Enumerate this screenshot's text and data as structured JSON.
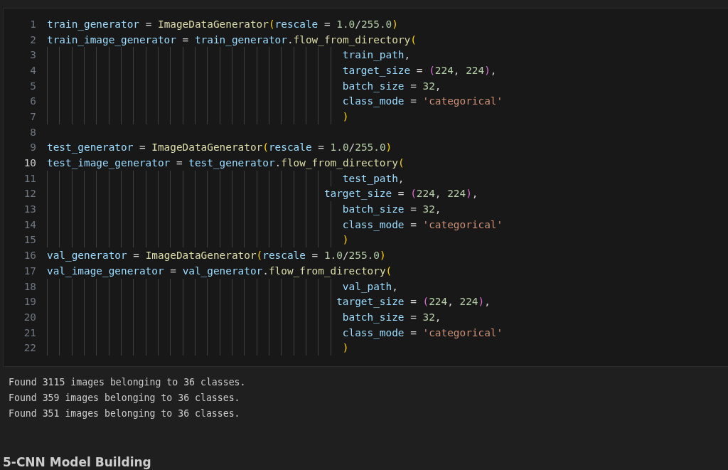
{
  "code_cell": {
    "lines": [
      {
        "number": "1",
        "current": false,
        "tokens": [
          {
            "text": "train_generator",
            "kind": "var"
          },
          {
            "text": " = ",
            "kind": "op"
          },
          {
            "text": "ImageDataGenerator",
            "kind": "func"
          },
          {
            "text": "(",
            "kind": "paren1"
          },
          {
            "text": "rescale",
            "kind": "param"
          },
          {
            "text": " = ",
            "kind": "op"
          },
          {
            "text": "1.0",
            "kind": "num"
          },
          {
            "text": "/",
            "kind": "op"
          },
          {
            "text": "255.0",
            "kind": "num"
          },
          {
            "text": ")",
            "kind": "paren1"
          }
        ]
      },
      {
        "number": "2",
        "current": false,
        "tokens": [
          {
            "text": "train_image_generator",
            "kind": "var"
          },
          {
            "text": " = ",
            "kind": "op"
          },
          {
            "text": "train_generator",
            "kind": "var"
          },
          {
            "text": ".",
            "kind": "op"
          },
          {
            "text": "flow_from_directory",
            "kind": "func"
          },
          {
            "text": "(",
            "kind": "paren1"
          }
        ]
      },
      {
        "number": "3",
        "current": false,
        "tokens": [
          {
            "text": "                                                train_path",
            "kind": "var"
          },
          {
            "text": ",",
            "kind": "op"
          }
        ]
      },
      {
        "number": "4",
        "current": false,
        "tokens": [
          {
            "text": "                                                target_size",
            "kind": "param"
          },
          {
            "text": " = ",
            "kind": "op"
          },
          {
            "text": "(",
            "kind": "paren2"
          },
          {
            "text": "224",
            "kind": "num"
          },
          {
            "text": ", ",
            "kind": "op"
          },
          {
            "text": "224",
            "kind": "num"
          },
          {
            "text": ")",
            "kind": "paren2"
          },
          {
            "text": ",",
            "kind": "op"
          }
        ]
      },
      {
        "number": "5",
        "current": false,
        "tokens": [
          {
            "text": "                                                batch_size",
            "kind": "param"
          },
          {
            "text": " = ",
            "kind": "op"
          },
          {
            "text": "32",
            "kind": "num"
          },
          {
            "text": ",",
            "kind": "op"
          }
        ]
      },
      {
        "number": "6",
        "current": false,
        "tokens": [
          {
            "text": "                                                class_mode",
            "kind": "param"
          },
          {
            "text": " = ",
            "kind": "op"
          },
          {
            "text": "'categorical'",
            "kind": "str"
          }
        ]
      },
      {
        "number": "7",
        "current": false,
        "tokens": [
          {
            "text": "                                                )",
            "kind": "paren1"
          }
        ]
      },
      {
        "number": "8",
        "current": false
      },
      {
        "number": "9",
        "current": false,
        "tokens": [
          {
            "text": "test_generator",
            "kind": "var"
          },
          {
            "text": " = ",
            "kind": "op"
          },
          {
            "text": "ImageDataGenerator",
            "kind": "func"
          },
          {
            "text": "(",
            "kind": "paren1"
          },
          {
            "text": "rescale",
            "kind": "param"
          },
          {
            "text": " = ",
            "kind": "op"
          },
          {
            "text": "1.0",
            "kind": "num"
          },
          {
            "text": "/",
            "kind": "op"
          },
          {
            "text": "255.0",
            "kind": "num"
          },
          {
            "text": ")",
            "kind": "paren1"
          }
        ]
      },
      {
        "number": "10",
        "current": true,
        "tokens": [
          {
            "text": "test_image_generator",
            "kind": "var"
          },
          {
            "text": " = ",
            "kind": "op"
          },
          {
            "text": "test_generator",
            "kind": "var"
          },
          {
            "text": ".",
            "kind": "op"
          },
          {
            "text": "flow_from_directory",
            "kind": "func"
          },
          {
            "text": "(",
            "kind": "paren1"
          }
        ]
      },
      {
        "number": "11",
        "current": false,
        "tokens": [
          {
            "text": "                                                test_path",
            "kind": "var"
          },
          {
            "text": ",",
            "kind": "op"
          }
        ]
      },
      {
        "number": "12",
        "current": false,
        "tokens": [
          {
            "text": "                                             target_size",
            "kind": "param"
          },
          {
            "text": " = ",
            "kind": "op"
          },
          {
            "text": "(",
            "kind": "paren2"
          },
          {
            "text": "224",
            "kind": "num"
          },
          {
            "text": ", ",
            "kind": "op"
          },
          {
            "text": "224",
            "kind": "num"
          },
          {
            "text": ")",
            "kind": "paren2"
          },
          {
            "text": ",",
            "kind": "op"
          }
        ]
      },
      {
        "number": "13",
        "current": false,
        "tokens": [
          {
            "text": "                                                batch_size",
            "kind": "param"
          },
          {
            "text": " = ",
            "kind": "op"
          },
          {
            "text": "32",
            "kind": "num"
          },
          {
            "text": ",",
            "kind": "op"
          }
        ]
      },
      {
        "number": "14",
        "current": false,
        "tokens": [
          {
            "text": "                                                class_mode",
            "kind": "param"
          },
          {
            "text": " = ",
            "kind": "op"
          },
          {
            "text": "'categorical'",
            "kind": "str"
          }
        ]
      },
      {
        "number": "15",
        "current": false,
        "tokens": [
          {
            "text": "                                                )",
            "kind": "paren1"
          }
        ]
      },
      {
        "number": "16",
        "current": false,
        "tokens": [
          {
            "text": "val_generator",
            "kind": "var"
          },
          {
            "text": " = ",
            "kind": "op"
          },
          {
            "text": "ImageDataGenerator",
            "kind": "func"
          },
          {
            "text": "(",
            "kind": "paren1"
          },
          {
            "text": "rescale",
            "kind": "param"
          },
          {
            "text": " = ",
            "kind": "op"
          },
          {
            "text": "1.0",
            "kind": "num"
          },
          {
            "text": "/",
            "kind": "op"
          },
          {
            "text": "255.0",
            "kind": "num"
          },
          {
            "text": ")",
            "kind": "paren1"
          }
        ]
      },
      {
        "number": "17",
        "current": false,
        "tokens": [
          {
            "text": "val_image_generator",
            "kind": "var"
          },
          {
            "text": " = ",
            "kind": "op"
          },
          {
            "text": "val_generator",
            "kind": "var"
          },
          {
            "text": ".",
            "kind": "op"
          },
          {
            "text": "flow_from_directory",
            "kind": "func"
          },
          {
            "text": "(",
            "kind": "paren1"
          }
        ]
      },
      {
        "number": "18",
        "current": false,
        "tokens": [
          {
            "text": "                                                val_path",
            "kind": "var"
          },
          {
            "text": ",",
            "kind": "op"
          }
        ]
      },
      {
        "number": "19",
        "current": false,
        "tokens": [
          {
            "text": "                                               target_size",
            "kind": "param"
          },
          {
            "text": " = ",
            "kind": "op"
          },
          {
            "text": "(",
            "kind": "paren2"
          },
          {
            "text": "224",
            "kind": "num"
          },
          {
            "text": ", ",
            "kind": "op"
          },
          {
            "text": "224",
            "kind": "num"
          },
          {
            "text": ")",
            "kind": "paren2"
          },
          {
            "text": ",",
            "kind": "op"
          }
        ]
      },
      {
        "number": "20",
        "current": false,
        "tokens": [
          {
            "text": "                                                batch_size",
            "kind": "param"
          },
          {
            "text": " = ",
            "kind": "op"
          },
          {
            "text": "32",
            "kind": "num"
          },
          {
            "text": ",",
            "kind": "op"
          }
        ]
      },
      {
        "number": "21",
        "current": false,
        "tokens": [
          {
            "text": "                                                class_mode",
            "kind": "param"
          },
          {
            "text": " = ",
            "kind": "op"
          },
          {
            "text": "'categorical'",
            "kind": "str"
          }
        ]
      },
      {
        "number": "22",
        "current": false,
        "tokens": [
          {
            "text": "                                                )",
            "kind": "paren1"
          }
        ]
      }
    ]
  },
  "output": [
    "Found 3115 images belonging to 36 classes.",
    "Found 359 images belonging to 36 classes.",
    "Found 351 images belonging to 36 classes."
  ],
  "heading": "5-CNN Model Building"
}
